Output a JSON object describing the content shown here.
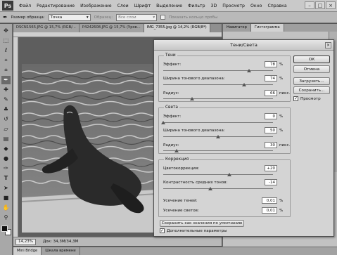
{
  "app": {
    "logo": "Ps",
    "menu": [
      "Файл",
      "Редактирование",
      "Изображение",
      "Слои",
      "Шрифт",
      "Выделение",
      "Фильтр",
      "3D",
      "Просмотр",
      "Окно",
      "Справка"
    ],
    "window_controls": [
      "–",
      "□",
      "×"
    ]
  },
  "options": {
    "sample_size_label": "Размер образца:",
    "sample_size_value": "Точка",
    "sample_label": "Образец:",
    "sample_value": "Все слои",
    "show_ring_label": "Показать кольцо пробы"
  },
  "doc_tabs": [
    {
      "label": "DSCN1565.JPG @ 15,7% (RGB/...",
      "active": false
    },
    {
      "label": "P4242608.JPG @ 15,7% (Уров...",
      "active": false
    },
    {
      "label": "IMG_7355.jpg @ 14,2% (RGB/8*)",
      "active": true
    }
  ],
  "status": {
    "zoom": "14,23%",
    "doc_info": "Док: 34,3М/34,3М"
  },
  "bottom_tabs": [
    "Mini Bridge",
    "Шкала времени"
  ],
  "right_tabs": [
    "Навигатор",
    "Гистограмма"
  ],
  "dialog": {
    "title": "Тени/Света",
    "close": "×",
    "shadows": {
      "legend": "Тени",
      "effect_label": "Эффект:",
      "effect_value": "78",
      "effect_unit": "%",
      "effect_level": 0.78,
      "tonal_label": "Ширина тонового диапазона:",
      "tonal_value": "74",
      "tonal_unit": "%",
      "tonal_level": 0.74,
      "radius_label": "Радиус:",
      "radius_value": "66",
      "radius_unit": "пикс.",
      "radius_level": 0.26
    },
    "highlights": {
      "legend": "Света",
      "effect_label": "Эффект:",
      "effect_value": "0",
      "effect_unit": "%",
      "effect_level": 0.0,
      "tonal_label": "Ширина тонового диапазона:",
      "tonal_value": "50",
      "tonal_unit": "%",
      "tonal_level": 0.5,
      "radius_label": "Радиус:",
      "radius_value": "30",
      "radius_unit": "пикс.",
      "radius_level": 0.12
    },
    "correction": {
      "legend": "Коррекция",
      "color_label": "Цветокоррекция:",
      "color_value": "+20",
      "color_level": 0.6,
      "midtone_label": "Контрастность средних тонов:",
      "midtone_value": "-14",
      "midtone_level": 0.43,
      "clip_shadows_label": "Усечение теней:",
      "clip_shadows_value": "0,01",
      "clip_highlights_label": "Усечение светов:",
      "clip_highlights_value": "0,01",
      "percent": "%"
    },
    "buttons": {
      "ok": "ОК",
      "cancel": "Отмена",
      "load": "Загрузить...",
      "save": "Сохранить..."
    },
    "preview_label": "Просмотр",
    "save_defaults_label": "Сохранить как значения по умолчанию",
    "more_options_label": "Дополнительные параметры"
  }
}
